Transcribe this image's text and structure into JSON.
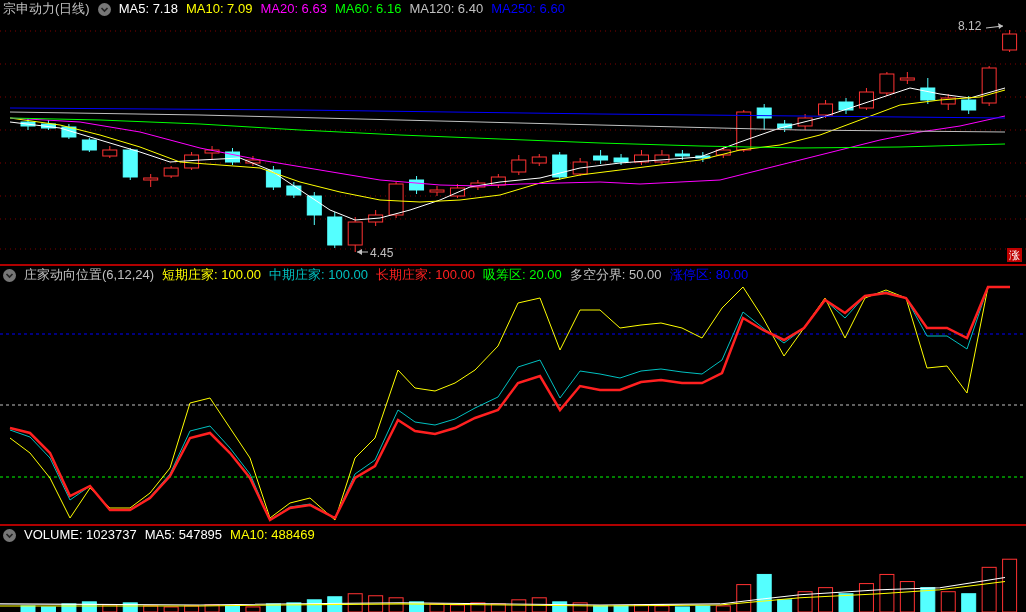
{
  "main_panel": {
    "title": "宗申动力(日线)",
    "indicators": [
      {
        "label": "MA5: 7.18",
        "color": "#ffffff"
      },
      {
        "label": "MA10: 7.09",
        "color": "#ffff00"
      },
      {
        "label": "MA20: 6.63",
        "color": "#ff00ff"
      },
      {
        "label": "MA60: 6.16",
        "color": "#00ff00"
      },
      {
        "label": "MA120: 6.40",
        "color": "#c0c0c0"
      },
      {
        "label": "MA250: 6.60",
        "color": "#0000ff"
      }
    ],
    "high_label": "8.12",
    "low_label": "4.45",
    "badge": "涨"
  },
  "indicator_panel": {
    "title": "庄家动向位置(6,12,24)",
    "indicators": [
      {
        "label": "短期庄家: 100.00",
        "color": "#ffff00"
      },
      {
        "label": "中期庄家: 100.00",
        "color": "#00c0c0"
      },
      {
        "label": "长期庄家: 100.00",
        "color": "#ff2020"
      },
      {
        "label": "吸筹区: 20.00",
        "color": "#00ff00"
      },
      {
        "label": "多空分界: 50.00",
        "color": "#c0c0c0"
      },
      {
        "label": "涨停区: 80.00",
        "color": "#0000ff"
      }
    ]
  },
  "volume_panel": {
    "indicators": [
      {
        "label": "VOLUME: 1023737",
        "color": "#ffffff"
      },
      {
        "label": "MA5: 547895",
        "color": "#ffffff"
      },
      {
        "label": "MA10: 488469",
        "color": "#ffff00"
      }
    ]
  }
}
